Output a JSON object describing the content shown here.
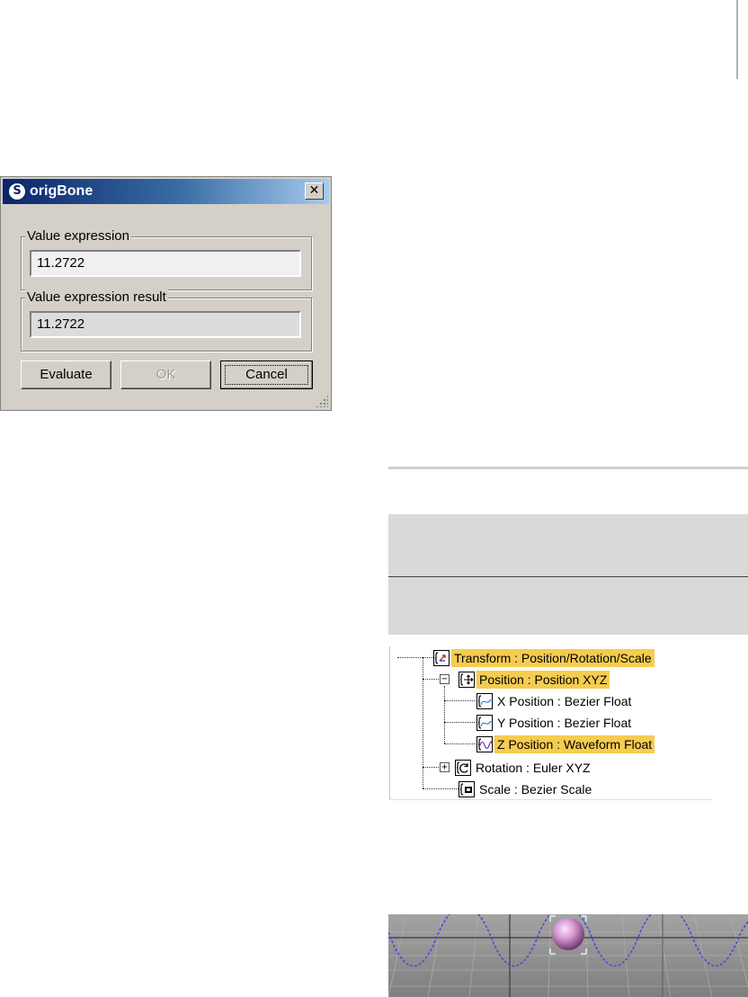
{
  "dialog": {
    "title": "origBone",
    "app_icon": "max-logo-icon",
    "close_glyph": "✕",
    "value_expression": {
      "legend": "Value expression",
      "value": "11.2722"
    },
    "value_expression_result": {
      "legend": "Value expression result",
      "value": "11.2722"
    },
    "buttons": {
      "evaluate": "Evaluate",
      "ok": "OK",
      "cancel": "Cancel"
    }
  },
  "tree": {
    "items": [
      {
        "label": "Transform : Position/Rotation/Scale",
        "icon": "transform-controller-icon",
        "highlighted": true
      },
      {
        "label": "Position : Position XYZ",
        "icon": "position-xyz-icon",
        "highlighted": true,
        "expander": "−"
      },
      {
        "label": "X Position : Bezier Float",
        "icon": "bezier-float-icon",
        "highlighted": false
      },
      {
        "label": "Y Position : Bezier Float",
        "icon": "bezier-float-icon",
        "highlighted": false
      },
      {
        "label": "Z Position : Waveform Float",
        "icon": "waveform-float-icon",
        "highlighted": true
      },
      {
        "label": "Rotation : Euler XYZ",
        "icon": "euler-rotation-icon",
        "highlighted": false,
        "expander": "+"
      },
      {
        "label": "Scale : Bezier Scale",
        "icon": "bezier-scale-icon",
        "highlighted": false
      }
    ]
  },
  "colors": {
    "highlight": "#f6cc50",
    "titlebar_start": "#0a246a",
    "dialog_face": "#d4d0c8",
    "trajectory": "#4a4ad8",
    "sphere": "#d79ad6"
  }
}
